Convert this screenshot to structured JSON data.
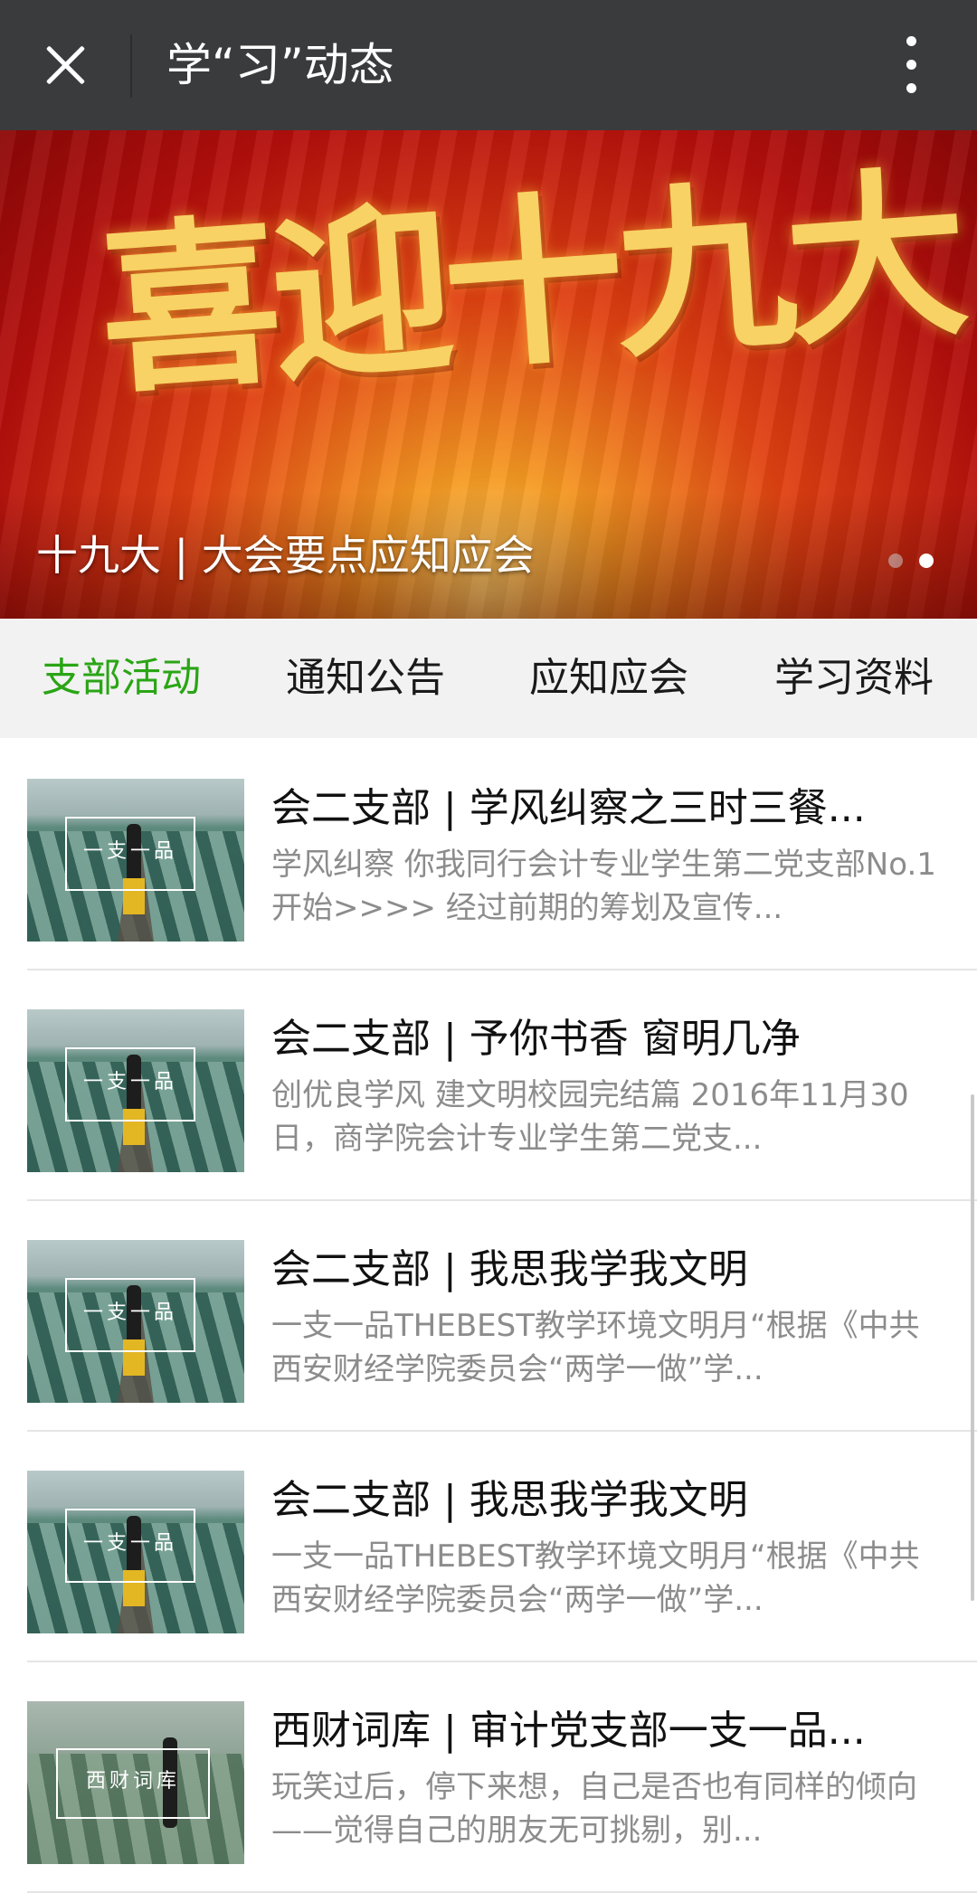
{
  "header": {
    "title": "学“习”动态",
    "close_icon": "close-icon",
    "more_icon": "more-vertical-icon"
  },
  "banner": {
    "art_text": "喜迎十九大",
    "caption": "十九大 | 大会要点应知应会",
    "slide_count": 2,
    "active_slide": 2
  },
  "tabs": [
    {
      "label": "支部活动",
      "active": true
    },
    {
      "label": "通知公告",
      "active": false
    },
    {
      "label": "应知应会",
      "active": false
    },
    {
      "label": "学习资料",
      "active": false
    }
  ],
  "colors": {
    "topbar": "#3a3b3d",
    "active_tab": "#2aa515",
    "tab_bar": "#f2f2f2",
    "desc_text": "#8c8c8c"
  },
  "articles": [
    {
      "thumb_text": "一支一品",
      "title": "会二支部 | 学风纠察之三时三餐...",
      "desc": "学风纠察 你我同行会计专业学生第二党支部No.1开始>>>> 经过前期的筹划及宣传..."
    },
    {
      "thumb_text": "一支一品",
      "title": "会二支部 | 予你书香 窗明几净",
      "desc": "创优良学风 建文明校园完结篇 2016年11月30日，商学院会计专业学生第二党支..."
    },
    {
      "thumb_text": "一支一品",
      "title": "会二支部 | 我思我学我文明",
      "desc": "一支一品THEBEST教学环境文明月“根据《中共西安财经学院委员会“两学一做”学..."
    },
    {
      "thumb_text": "一支一品",
      "title": "会二支部 | 我思我学我文明",
      "desc": "一支一品THEBEST教学环境文明月“根据《中共西安财经学院委员会“两学一做”学..."
    },
    {
      "thumb_text": "西财词库",
      "title": "西财词库 | 审计党支部一支一品...",
      "desc": "玩笑过后，停下来想，自己是否也有同样的倾向——觉得自己的朋友无可挑剔，别..."
    }
  ]
}
